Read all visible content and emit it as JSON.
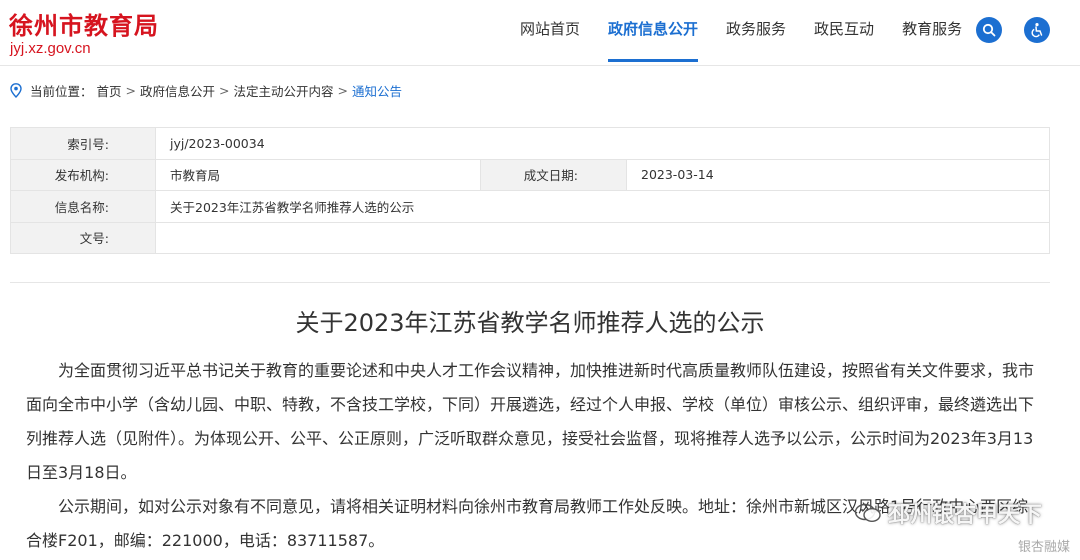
{
  "site": {
    "name": "徐州市教育局",
    "domain": "jyj.xz.gov.cn"
  },
  "nav": {
    "items": [
      {
        "label": "网站首页",
        "active": false
      },
      {
        "label": "政府信息公开",
        "active": true
      },
      {
        "label": "政务服务",
        "active": false
      },
      {
        "label": "政民互动",
        "active": false
      },
      {
        "label": "教育服务",
        "active": false
      }
    ],
    "search_icon": "search-icon",
    "accessibility_icon": "accessibility-icon",
    "accent_color": "#1c6fd1"
  },
  "breadcrumb": {
    "prefix": "当前位置：",
    "items": [
      "首页",
      "政府信息公开",
      "法定主动公开内容",
      "通知公告"
    ],
    "separators": [
      ">",
      ">",
      ">"
    ]
  },
  "meta": {
    "index_label": "索引号:",
    "index_value": "jyj/2023-00034",
    "publisher_label": "发布机构:",
    "publisher_value": "市教育局",
    "date_label": "成文日期:",
    "date_value": "2023-03-14",
    "info_name_label": "信息名称:",
    "info_name_value": "关于2023年江苏省教学名师推荐人选的公示",
    "doc_no_label": "文号:",
    "doc_no_value": ""
  },
  "article": {
    "title": "关于2023年江苏省教学名师推荐人选的公示",
    "paragraphs": [
      "为全面贯彻习近平总书记关于教育的重要论述和中央人才工作会议精神，加快推进新时代高质量教师队伍建设，按照省有关文件要求，我市面向全市中小学（含幼儿园、中职、特教，不含技工学校，下同）开展遴选，经过个人申报、学校（单位）审核公示、组织评审，最终遴选出下列推荐人选（见附件）。为体现公开、公平、公正原则，广泛听取群众意见，接受社会监督，现将推荐人选予以公示，公示时间为2023年3月13日至3月18日。",
      "公示期间，如对公示对象有不同意见，请将相关证明材料向徐州市教育局教师工作处反映。地址：徐州市新城区汉风路1号行政中心西区综合楼F201，邮编：221000，电话：83711587。"
    ]
  },
  "watermark": {
    "text": "邳州银杏甲天下",
    "sub": "银杏融媒"
  }
}
